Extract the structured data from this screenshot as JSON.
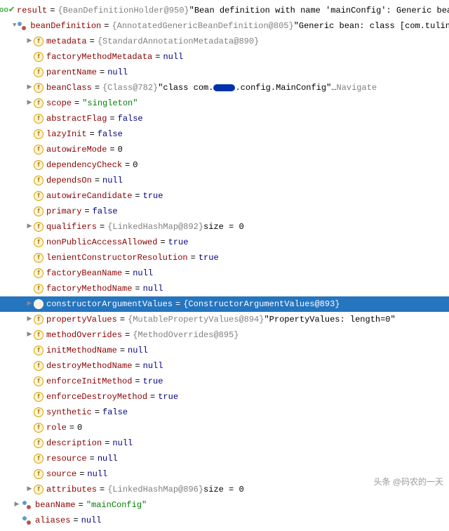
{
  "watermark": "头条 @码农的一天",
  "rows": [
    {
      "indent": 0,
      "arrow": "",
      "iconKind": "check",
      "iconText": "",
      "nameBind": "r0.name",
      "tail": [
        {
          "cls": "eq",
          "bind": "r0.eq"
        },
        {
          "cls": "type",
          "bind": "r0.type"
        },
        {
          "cls": "val-txt",
          "bind": "r0.val"
        }
      ]
    },
    {
      "indent": 1,
      "arrow": "▼",
      "iconKind": "oo",
      "nameBind": "r1.name",
      "tail": [
        {
          "cls": "eq",
          "bind": "r1.eq"
        },
        {
          "cls": "type",
          "bind": "r1.type"
        },
        {
          "cls": "val-txt",
          "bind": "r1.val"
        }
      ]
    },
    {
      "indent": 2,
      "arrow": "▶",
      "iconKind": "f",
      "nameBind": "r2.name",
      "tail": [
        {
          "cls": "eq",
          "bind": "r2.eq"
        },
        {
          "cls": "type",
          "bind": "r2.type"
        }
      ]
    },
    {
      "indent": 2,
      "arrow": "",
      "iconKind": "f",
      "nameBind": "r3.name",
      "tail": [
        {
          "cls": "eq",
          "bind": "r3.eq"
        },
        {
          "cls": "val-kw",
          "bind": "r3.val"
        }
      ]
    },
    {
      "indent": 2,
      "arrow": "",
      "iconKind": "f",
      "nameBind": "r4.name",
      "tail": [
        {
          "cls": "eq",
          "bind": "r4.eq"
        },
        {
          "cls": "val-kw",
          "bind": "r4.val"
        }
      ]
    },
    {
      "indent": 2,
      "arrow": "▶",
      "iconKind": "f",
      "nameBind": "r5.name",
      "tail": [
        {
          "cls": "eq",
          "bind": "r5.eq"
        },
        {
          "cls": "type",
          "bind": "r5.type"
        },
        {
          "cls": "val-txt",
          "bind": "r5.pre"
        },
        {
          "cls": "obscure",
          "bind": "r5.obs"
        },
        {
          "cls": "val-txt",
          "bind": "r5.post"
        },
        {
          "cls": "nav",
          "bind": "r5.nav"
        }
      ]
    },
    {
      "indent": 2,
      "arrow": "▶",
      "iconKind": "f",
      "nameBind": "r6.name",
      "tail": [
        {
          "cls": "eq",
          "bind": "r6.eq"
        },
        {
          "cls": "val-str",
          "bind": "r6.val"
        }
      ]
    },
    {
      "indent": 2,
      "arrow": "",
      "iconKind": "f",
      "nameBind": "r7.name",
      "tail": [
        {
          "cls": "eq",
          "bind": "r7.eq"
        },
        {
          "cls": "val-kw",
          "bind": "r7.val"
        }
      ]
    },
    {
      "indent": 2,
      "arrow": "",
      "iconKind": "f",
      "nameBind": "r8.name",
      "tail": [
        {
          "cls": "eq",
          "bind": "r8.eq"
        },
        {
          "cls": "val-kw",
          "bind": "r8.val"
        }
      ]
    },
    {
      "indent": 2,
      "arrow": "",
      "iconKind": "f",
      "nameBind": "r9.name",
      "tail": [
        {
          "cls": "eq",
          "bind": "r9.eq"
        },
        {
          "cls": "val-txt",
          "bind": "r9.val"
        }
      ]
    },
    {
      "indent": 2,
      "arrow": "",
      "iconKind": "f",
      "nameBind": "r10.name",
      "tail": [
        {
          "cls": "eq",
          "bind": "r10.eq"
        },
        {
          "cls": "val-txt",
          "bind": "r10.val"
        }
      ]
    },
    {
      "indent": 2,
      "arrow": "",
      "iconKind": "f",
      "nameBind": "r11.name",
      "tail": [
        {
          "cls": "eq",
          "bind": "r11.eq"
        },
        {
          "cls": "val-kw",
          "bind": "r11.val"
        }
      ]
    },
    {
      "indent": 2,
      "arrow": "",
      "iconKind": "f",
      "nameBind": "r12.name",
      "tail": [
        {
          "cls": "eq",
          "bind": "r12.eq"
        },
        {
          "cls": "val-kw",
          "bind": "r12.val"
        }
      ]
    },
    {
      "indent": 2,
      "arrow": "",
      "iconKind": "f",
      "nameBind": "r13.name",
      "tail": [
        {
          "cls": "eq",
          "bind": "r13.eq"
        },
        {
          "cls": "val-kw",
          "bind": "r13.val"
        }
      ]
    },
    {
      "indent": 2,
      "arrow": "▶",
      "iconKind": "map",
      "nameBind": "r14.name",
      "tail": [
        {
          "cls": "eq",
          "bind": "r14.eq"
        },
        {
          "cls": "type",
          "bind": "r14.type"
        },
        {
          "cls": "val-txt",
          "bind": "r14.val"
        }
      ]
    },
    {
      "indent": 2,
      "arrow": "",
      "iconKind": "f",
      "nameBind": "r15.name",
      "tail": [
        {
          "cls": "eq",
          "bind": "r15.eq"
        },
        {
          "cls": "val-kw",
          "bind": "r15.val"
        }
      ]
    },
    {
      "indent": 2,
      "arrow": "",
      "iconKind": "f",
      "nameBind": "r16.name",
      "tail": [
        {
          "cls": "eq",
          "bind": "r16.eq"
        },
        {
          "cls": "val-kw",
          "bind": "r16.val"
        }
      ]
    },
    {
      "indent": 2,
      "arrow": "",
      "iconKind": "f",
      "nameBind": "r17.name",
      "tail": [
        {
          "cls": "eq",
          "bind": "r17.eq"
        },
        {
          "cls": "val-kw",
          "bind": "r17.val"
        }
      ]
    },
    {
      "indent": 2,
      "arrow": "",
      "iconKind": "f",
      "nameBind": "r18.name",
      "tail": [
        {
          "cls": "eq",
          "bind": "r18.eq"
        },
        {
          "cls": "val-kw",
          "bind": "r18.val"
        }
      ]
    },
    {
      "indent": 2,
      "arrow": "▶",
      "iconKind": "f",
      "nameBind": "r19.name",
      "selected": true,
      "tail": [
        {
          "cls": "eq",
          "bind": "r19.eq"
        },
        {
          "cls": "type",
          "bind": "r19.type"
        }
      ]
    },
    {
      "indent": 2,
      "arrow": "▶",
      "iconKind": "f",
      "nameBind": "r20.name",
      "tail": [
        {
          "cls": "eq",
          "bind": "r20.eq"
        },
        {
          "cls": "type",
          "bind": "r20.type"
        },
        {
          "cls": "val-txt",
          "bind": "r20.val"
        }
      ]
    },
    {
      "indent": 2,
      "arrow": "▶",
      "iconKind": "f",
      "nameBind": "r21.name",
      "tail": [
        {
          "cls": "eq",
          "bind": "r21.eq"
        },
        {
          "cls": "type",
          "bind": "r21.type"
        }
      ]
    },
    {
      "indent": 2,
      "arrow": "",
      "iconKind": "f",
      "nameBind": "r22.name",
      "tail": [
        {
          "cls": "eq",
          "bind": "r22.eq"
        },
        {
          "cls": "val-kw",
          "bind": "r22.val"
        }
      ]
    },
    {
      "indent": 2,
      "arrow": "",
      "iconKind": "f",
      "nameBind": "r23.name",
      "tail": [
        {
          "cls": "eq",
          "bind": "r23.eq"
        },
        {
          "cls": "val-kw",
          "bind": "r23.val"
        }
      ]
    },
    {
      "indent": 2,
      "arrow": "",
      "iconKind": "f",
      "nameBind": "r24.name",
      "tail": [
        {
          "cls": "eq",
          "bind": "r24.eq"
        },
        {
          "cls": "val-kw",
          "bind": "r24.val"
        }
      ]
    },
    {
      "indent": 2,
      "arrow": "",
      "iconKind": "f",
      "nameBind": "r25.name",
      "tail": [
        {
          "cls": "eq",
          "bind": "r25.eq"
        },
        {
          "cls": "val-kw",
          "bind": "r25.val"
        }
      ]
    },
    {
      "indent": 2,
      "arrow": "",
      "iconKind": "f",
      "nameBind": "r26.name",
      "tail": [
        {
          "cls": "eq",
          "bind": "r26.eq"
        },
        {
          "cls": "val-kw",
          "bind": "r26.val"
        }
      ]
    },
    {
      "indent": 2,
      "arrow": "",
      "iconKind": "f",
      "nameBind": "r27.name",
      "tail": [
        {
          "cls": "eq",
          "bind": "r27.eq"
        },
        {
          "cls": "val-txt",
          "bind": "r27.val"
        }
      ]
    },
    {
      "indent": 2,
      "arrow": "",
      "iconKind": "f",
      "nameBind": "r28.name",
      "tail": [
        {
          "cls": "eq",
          "bind": "r28.eq"
        },
        {
          "cls": "val-kw",
          "bind": "r28.val"
        }
      ]
    },
    {
      "indent": 2,
      "arrow": "",
      "iconKind": "f",
      "nameBind": "r29.name",
      "tail": [
        {
          "cls": "eq",
          "bind": "r29.eq"
        },
        {
          "cls": "val-kw",
          "bind": "r29.val"
        }
      ]
    },
    {
      "indent": 2,
      "arrow": "",
      "iconKind": "f",
      "nameBind": "r30.name",
      "tail": [
        {
          "cls": "eq",
          "bind": "r30.eq"
        },
        {
          "cls": "val-kw",
          "bind": "r30.val"
        }
      ]
    },
    {
      "indent": 2,
      "arrow": "▶",
      "iconKind": "map",
      "nameBind": "r31.name",
      "tail": [
        {
          "cls": "eq",
          "bind": "r31.eq"
        },
        {
          "cls": "type",
          "bind": "r31.type"
        },
        {
          "cls": "val-txt",
          "bind": "r31.val"
        }
      ]
    },
    {
      "indent": 1,
      "arrow": "▶",
      "iconKind": "oo",
      "nameBind": "r32.name",
      "tail": [
        {
          "cls": "eq",
          "bind": "r32.eq"
        },
        {
          "cls": "val-str",
          "bind": "r32.val"
        }
      ]
    },
    {
      "indent": 1,
      "arrow": "",
      "iconKind": "oo",
      "nameBind": "r33.name",
      "tail": [
        {
          "cls": "eq",
          "bind": "r33.eq"
        },
        {
          "cls": "val-kw",
          "bind": "r33.val"
        }
      ]
    }
  ],
  "r0": {
    "name": "result",
    "eq": " = ",
    "type": "{BeanDefinitionHolder@950} ",
    "val": "\"Bean definition with name 'mainConfig': Generic bean: cla"
  },
  "r1": {
    "name": "beanDefinition",
    "eq": " = ",
    "type": "{AnnotatedGenericBeanDefinition@805} ",
    "val": "\"Generic bean: class [com.tuling.conf"
  },
  "r2": {
    "name": "metadata",
    "eq": " = ",
    "type": "{StandardAnnotationMetadata@890}"
  },
  "r3": {
    "name": "factoryMethodMetadata",
    "eq": " = ",
    "val": "null"
  },
  "r4": {
    "name": "parentName",
    "eq": " = ",
    "val": "null"
  },
  "r5": {
    "name": "beanClass",
    "eq": " = ",
    "type": "{Class@782} ",
    "pre": "\"class com.",
    "obs": "xxxxx",
    "post": ".config.MainConfig\"… ",
    "nav": "Navigate"
  },
  "r6": {
    "name": "scope",
    "eq": " = ",
    "val": "\"singleton\""
  },
  "r7": {
    "name": "abstractFlag",
    "eq": " = ",
    "val": "false"
  },
  "r8": {
    "name": "lazyInit",
    "eq": " = ",
    "val": "false"
  },
  "r9": {
    "name": "autowireMode",
    "eq": " = ",
    "val": "0"
  },
  "r10": {
    "name": "dependencyCheck",
    "eq": " = ",
    "val": "0"
  },
  "r11": {
    "name": "dependsOn",
    "eq": " = ",
    "val": "null"
  },
  "r12": {
    "name": "autowireCandidate",
    "eq": " = ",
    "val": "true"
  },
  "r13": {
    "name": "primary",
    "eq": " = ",
    "val": "false"
  },
  "r14": {
    "name": "qualifiers",
    "eq": " = ",
    "type": "{LinkedHashMap@892} ",
    "val": " size = 0"
  },
  "r15": {
    "name": "nonPublicAccessAllowed",
    "eq": " = ",
    "val": "true"
  },
  "r16": {
    "name": "lenientConstructorResolution",
    "eq": " = ",
    "val": "true"
  },
  "r17": {
    "name": "factoryBeanName",
    "eq": " = ",
    "val": "null"
  },
  "r18": {
    "name": "factoryMethodName",
    "eq": " = ",
    "val": "null"
  },
  "r19": {
    "name": "constructorArgumentValues",
    "eq": " = ",
    "type": "{ConstructorArgumentValues@893}"
  },
  "r20": {
    "name": "propertyValues",
    "eq": " = ",
    "type": "{MutablePropertyValues@894} ",
    "val": "\"PropertyValues: length=0\""
  },
  "r21": {
    "name": "methodOverrides",
    "eq": " = ",
    "type": "{MethodOverrides@895}"
  },
  "r22": {
    "name": "initMethodName",
    "eq": " = ",
    "val": "null"
  },
  "r23": {
    "name": "destroyMethodName",
    "eq": " = ",
    "val": "null"
  },
  "r24": {
    "name": "enforceInitMethod",
    "eq": " = ",
    "val": "true"
  },
  "r25": {
    "name": "enforceDestroyMethod",
    "eq": " = ",
    "val": "true"
  },
  "r26": {
    "name": "synthetic",
    "eq": " = ",
    "val": "false"
  },
  "r27": {
    "name": "role",
    "eq": " = ",
    "val": "0"
  },
  "r28": {
    "name": "description",
    "eq": " = ",
    "val": "null"
  },
  "r29": {
    "name": "resource",
    "eq": " = ",
    "val": "null"
  },
  "r30": {
    "name": "source",
    "eq": " = ",
    "val": "null"
  },
  "r31": {
    "name": "attributes",
    "eq": " = ",
    "type": "{LinkedHashMap@896} ",
    "val": " size = 0"
  },
  "r32": {
    "name": "beanName",
    "eq": " = ",
    "val": "\"mainConfig\""
  },
  "r33": {
    "name": "aliases",
    "eq": " = ",
    "val": "null"
  }
}
